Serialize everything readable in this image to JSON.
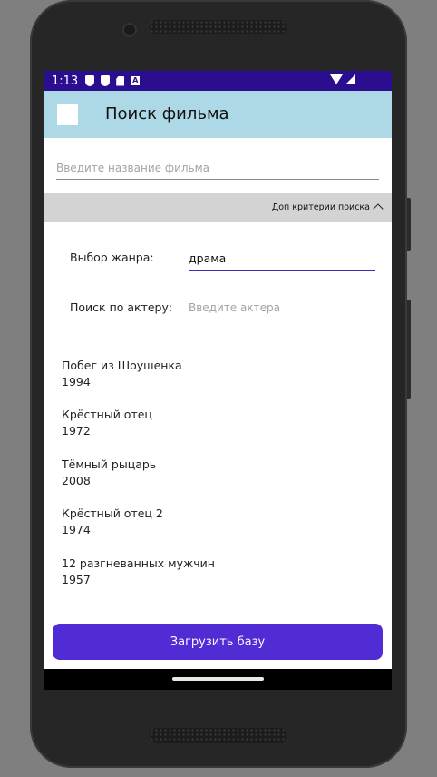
{
  "status_bar": {
    "time": "1:13",
    "icons": [
      "shield-icon",
      "shield-check-icon",
      "sd-card-icon",
      "a-badge-icon",
      "wifi-icon",
      "signal-icon"
    ]
  },
  "app_bar": {
    "title": "Поиск фильма",
    "background": "#add8e6"
  },
  "search": {
    "film_placeholder": "Введите название фильма",
    "film_value": ""
  },
  "criteria": {
    "toggle_label": "Доп критерии поиска",
    "genre_label": "Выбор жанра:",
    "genre_value": "драма",
    "actor_label": "Поиск по актеру:",
    "actor_placeholder": "Введите актера",
    "actor_value": ""
  },
  "movies": [
    {
      "title": "Побег из Шоушенка",
      "year": "1994"
    },
    {
      "title": "Крёстный отец",
      "year": "1972"
    },
    {
      "title": "Тёмный рыцарь",
      "year": "2008"
    },
    {
      "title": "Крёстный отец 2",
      "year": "1974"
    },
    {
      "title": "12 разгневанных мужчин",
      "year": "1957"
    }
  ],
  "actions": {
    "load_button": "Загрузить базу",
    "accent": "#512bd4"
  }
}
